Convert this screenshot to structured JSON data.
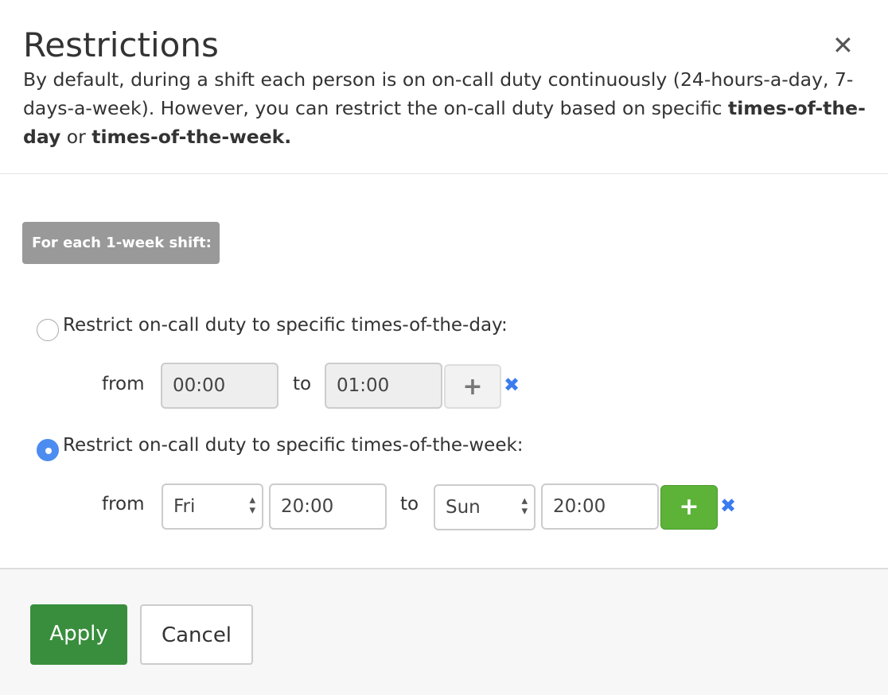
{
  "dialog": {
    "title": "Restrictions",
    "close_icon": "close-icon",
    "description": {
      "text": "By default, during a shift each person is on on-call duty continuously (24-hours-a-day, 7-days-a-week). However, you can restrict the on-call duty based on specific ",
      "bold1": "times-of-the-day",
      "or": " or ",
      "bold2": "times-of-the-week."
    }
  },
  "shift_badge": "For each 1-week shift:",
  "day_option": {
    "label": "Restrict on-call duty to specific times-of-the-day:",
    "selected": false,
    "from_label": "from",
    "from": "00:00",
    "to_label": "to",
    "to": "01:00",
    "add": "+",
    "remove": "✖"
  },
  "week_option": {
    "label": "Restrict on-call duty to specific times-of-the-week:",
    "selected": true,
    "from_label": "from",
    "from_day": "Fri",
    "from_time": "20:00",
    "to_label": "to",
    "to_day": "Sun",
    "to_time": "20:00",
    "add": "+",
    "remove": "✖"
  },
  "footer": {
    "apply": "Apply",
    "cancel": "Cancel"
  },
  "colors": {
    "apply": "#388e3c",
    "add_active": "#5cb338",
    "radio_selected": "#4c8cf0",
    "remove": "#3b7bf0"
  }
}
